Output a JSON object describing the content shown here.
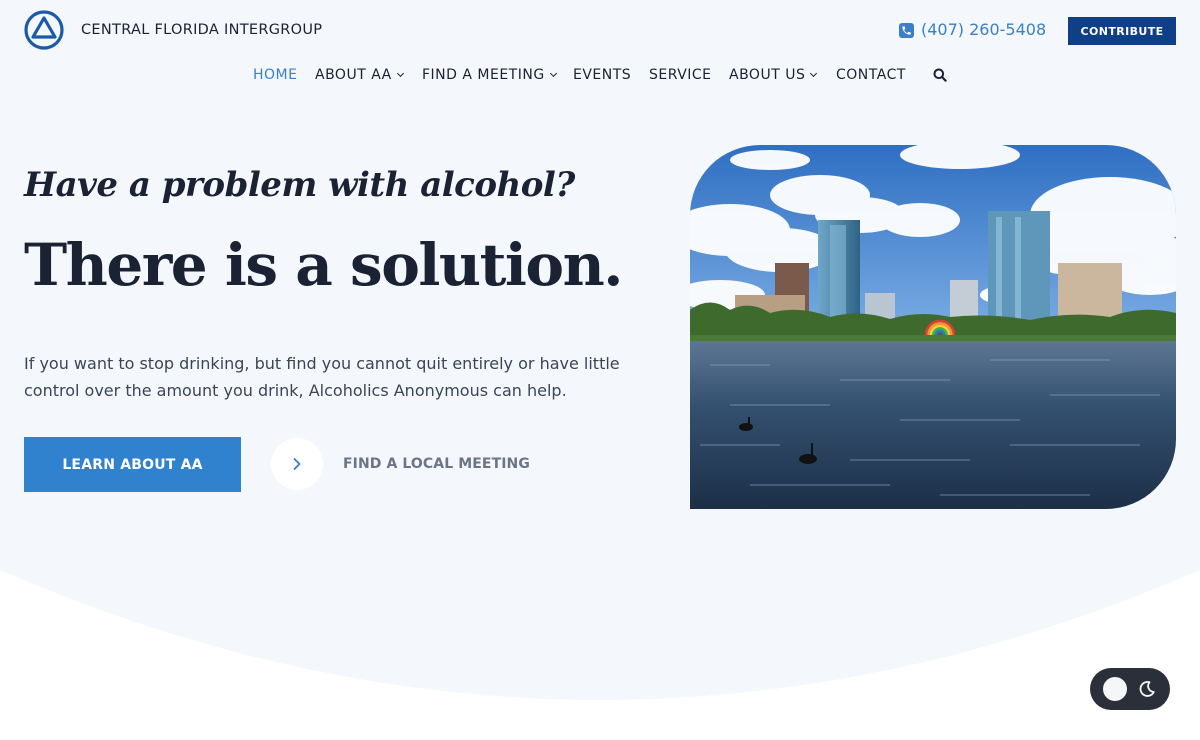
{
  "header": {
    "brand": "CENTRAL FLORIDA INTERGROUP",
    "phone": "(407) 260-5408",
    "contribute_label": "CONTRIBUTE"
  },
  "nav": {
    "items": [
      {
        "label": "HOME",
        "active": true
      },
      {
        "label": "ABOUT AA",
        "dropdown": true
      },
      {
        "label": "FIND A MEETING",
        "dropdown": true
      },
      {
        "label": "EVENTS"
      },
      {
        "label": "SERVICE"
      },
      {
        "label": "ABOUT US",
        "dropdown": true
      },
      {
        "label": "CONTACT"
      }
    ]
  },
  "hero": {
    "tagline": "Have a problem with alcohol?",
    "headline": "There is a solution.",
    "intro": "If you want to stop drinking, but find you cannot quit entirely or have little control over the amount you drink, Alcoholics Anonymous can help.",
    "primary_button": "LEARN ABOUT AA",
    "secondary_link": "FIND A LOCAL MEETING"
  },
  "icons": {
    "logo": "triangle-in-circle-logo",
    "phone": "phone-icon",
    "search": "search-icon",
    "arrow": "chevron-right-icon",
    "theme_toggle": "moon-icon"
  },
  "colors": {
    "accent": "#3182ce",
    "contribute_bg": "#0f3f87",
    "page_bg": "#f4f8fc",
    "toggle_bg": "#2a2f3a"
  }
}
